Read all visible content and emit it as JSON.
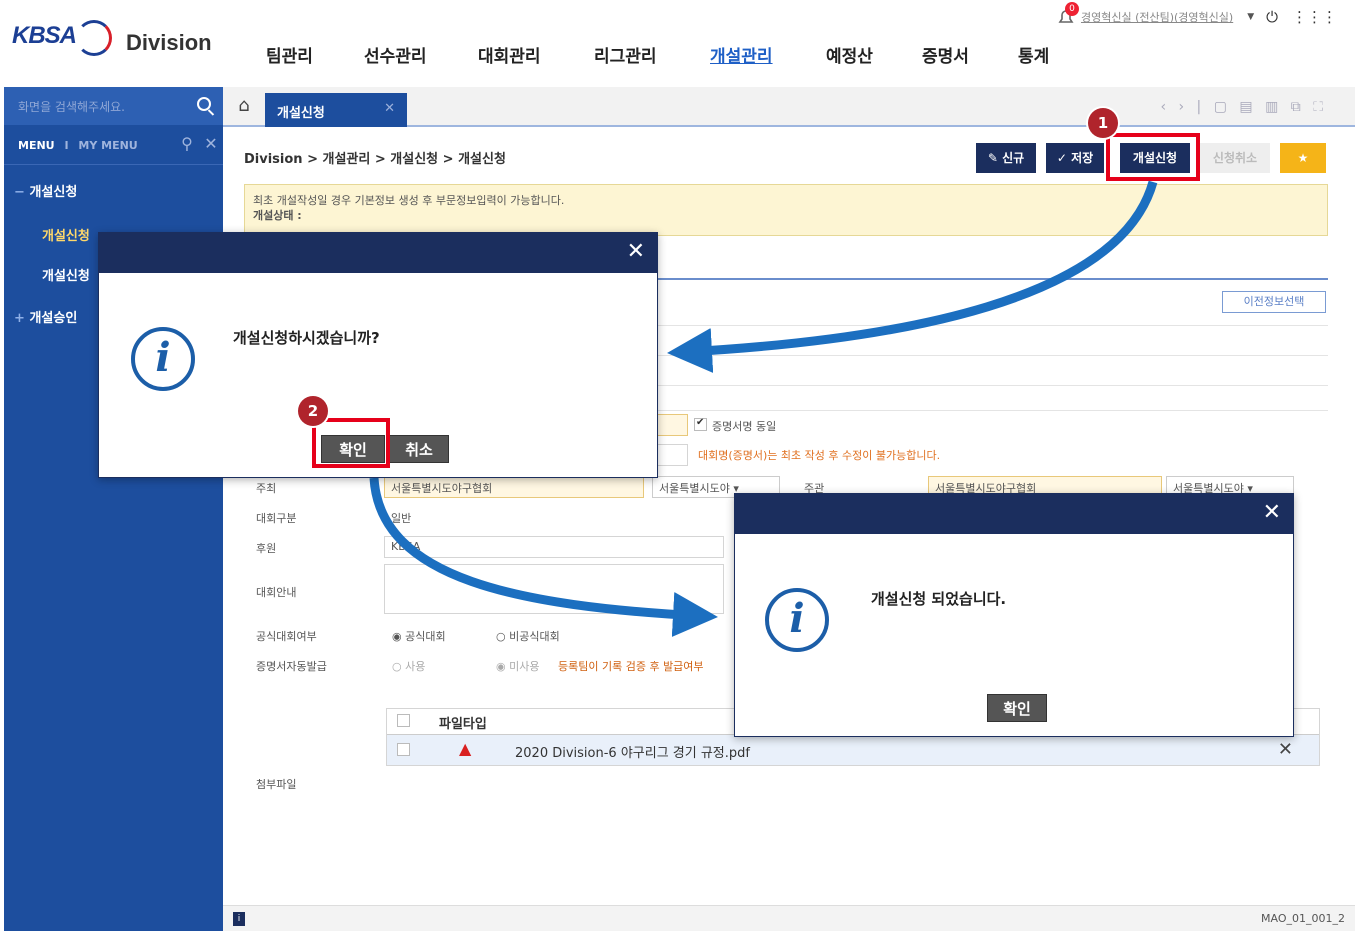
{
  "header": {
    "logo": "KBSA",
    "division": "Division",
    "user": "경영혁신실 (전산팀)(경영혁신실)",
    "notifications": "0",
    "nav": [
      "팀관리",
      "선수관리",
      "대회관리",
      "리그관리",
      "개설관리",
      "예정산",
      "증명서",
      "통계"
    ],
    "active_nav": "개설관리"
  },
  "sidebar": {
    "search_placeholder": "화면을 검색해주세요.",
    "menu_tab": "MENU",
    "my_menu_tab": "MY MENU",
    "items": [
      {
        "label": "개설신청",
        "expanded": true
      },
      {
        "label": "개설신청"
      },
      {
        "label": "개설신청"
      },
      {
        "label": "개설승인"
      }
    ]
  },
  "tabs": {
    "active": "개설신청"
  },
  "breadcrumb": "Division > 개설관리 > 개설신청 > 개설신청",
  "toolbar": {
    "new": "신규",
    "save": "저장",
    "apply": "개설신청",
    "cancel_apply": "신청취소"
  },
  "notice": {
    "line1": "최초 개설작성일 경우 기본정보 생성 후 부문정보입력이 가능합니다.",
    "line2": "개설상태 :"
  },
  "form": {
    "prev_info": "이전정보선택",
    "same_cert": "증명서명 동일",
    "cert_warning": "대회명(증명서)는 최초 작성 후 수정이 불가능합니다.",
    "host_label": "주최",
    "host_value": "서울특별시도야구협회",
    "host_region": "서울특별시도야",
    "organizer_label": "주관",
    "organizer_value": "서울특별시도야구협회",
    "organizer_region": "서울특별시도야",
    "category_label": "대회구분",
    "category_value": "일반",
    "sponsor_label": "후원",
    "sponsor_value": "KBSA",
    "guide_label": "대회안내",
    "official_label": "공식대회여부",
    "official_yes": "공식대회",
    "official_no": "비공식대회",
    "auto_cert_label": "증명서자동발급",
    "auto_use": "사용",
    "auto_unuse": "미사용",
    "auto_note": "등록팀이 기록 검증 후 발급여부",
    "attach_label": "첨부파일",
    "file_col": "파일타입",
    "file_name": "2020 Division-6 야구리그 경기 규정.pdf"
  },
  "modal1": {
    "message": "개설신청하시겠습니까?",
    "ok": "확인",
    "cancel": "취소"
  },
  "modal2": {
    "message": "개설신청 되었습니다.",
    "ok": "확인"
  },
  "callouts": {
    "step1": "1",
    "step2": "2"
  },
  "status": {
    "screen_id": "MAO_01_001_2"
  },
  "colors": {
    "primary": "#1d4e9e",
    "navy": "#1b2e5e",
    "highlight": "#e6001a",
    "arrow": "#1c6fc0"
  }
}
